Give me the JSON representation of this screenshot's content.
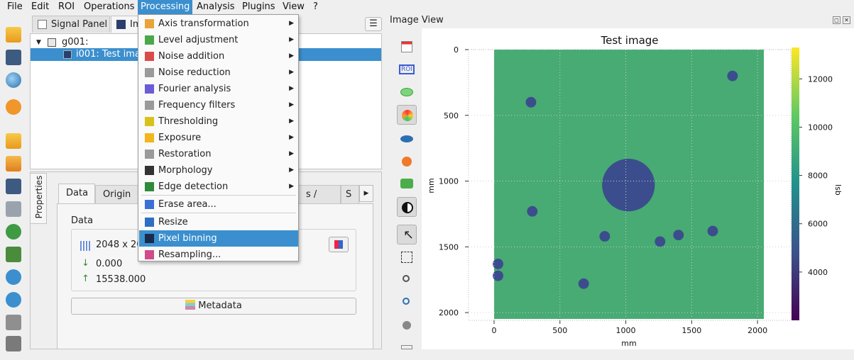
{
  "menubar": {
    "items": [
      "File",
      "Edit",
      "ROI",
      "Operations",
      "Processing",
      "Analysis",
      "Plugins",
      "View",
      "?"
    ],
    "active": "Processing"
  },
  "toolbar_icons": [
    "open-signal-icon",
    "save-icon",
    "search-icon",
    "settings-icon",
    "open-folder-icon",
    "upload-icon",
    "save-as-icon",
    "duplicate-icon",
    "refresh-icon",
    "import-icon",
    "move-up-icon",
    "move-down-icon",
    "copy-icon",
    "delete-icon"
  ],
  "panel_tabs": {
    "signal": "Signal Panel",
    "image": "Im"
  },
  "tree": {
    "group": "g001:",
    "item": "i001: Test imag"
  },
  "properties": {
    "side_label": "Properties",
    "tabs": [
      "Data",
      "Origin /",
      "s / Units",
      "S"
    ],
    "section_title": "Data",
    "size": "2048 x 20",
    "min": "0.000",
    "max": "15538.000",
    "metadata_label": "Metadata"
  },
  "processing_menu": [
    {
      "label": "Axis transformation",
      "icon": "axis-icon",
      "submenu": true
    },
    {
      "label": "Level adjustment",
      "icon": "level-icon",
      "submenu": true
    },
    {
      "label": "Noise addition",
      "icon": "noise-add-icon",
      "submenu": true
    },
    {
      "label": "Noise reduction",
      "icon": "noise-reduce-icon",
      "submenu": true
    },
    {
      "label": "Fourier analysis",
      "icon": "fourier-icon",
      "submenu": true
    },
    {
      "label": "Frequency filters",
      "icon": "filter-icon",
      "submenu": true
    },
    {
      "label": "Thresholding",
      "icon": "threshold-icon",
      "submenu": true
    },
    {
      "label": "Exposure",
      "icon": "exposure-icon",
      "submenu": true
    },
    {
      "label": "Restoration",
      "icon": "restoration-icon",
      "submenu": true
    },
    {
      "label": "Morphology",
      "icon": "morphology-icon",
      "submenu": true
    },
    {
      "label": "Edge detection",
      "icon": "edge-icon",
      "submenu": true
    },
    {
      "label": "Erase area...",
      "icon": "eraser-icon",
      "submenu": false
    },
    {
      "label": "Resize",
      "icon": "resize-icon",
      "submenu": false
    },
    {
      "label": "Pixel binning",
      "icon": "binning-icon",
      "submenu": false,
      "highlighted": true
    },
    {
      "label": "Resampling...",
      "icon": "resampling-icon",
      "submenu": false
    }
  ],
  "image_view": {
    "title": "Image View",
    "plot_title": "Test image",
    "xlabel": "mm",
    "ylabel": "mm",
    "colorbar_label": "lsb",
    "x_ticks": [
      "0",
      "500",
      "1000",
      "1500",
      "2000"
    ],
    "y_ticks": [
      "0",
      "500",
      "1000",
      "1500",
      "2000"
    ],
    "cbar_ticks": [
      "12000",
      "10000",
      "8000",
      "6000",
      "4000"
    ]
  },
  "chart_data": {
    "type": "heatmap",
    "title": "Test image",
    "xlabel": "mm",
    "ylabel": "mm",
    "colorbar_label": "lsb",
    "xlim": [
      0,
      2048
    ],
    "ylim": [
      2048,
      0
    ],
    "colorbar_range": [
      2000,
      13300
    ],
    "colormap": "viridis",
    "background_value": 7400,
    "spots": [
      {
        "x": 1810,
        "y": 200,
        "r": 40
      },
      {
        "x": 280,
        "y": 400,
        "r": 40
      },
      {
        "x": 1020,
        "y": 1030,
        "r": 200
      },
      {
        "x": 290,
        "y": 1230,
        "r": 40
      },
      {
        "x": 840,
        "y": 1420,
        "r": 40
      },
      {
        "x": 1260,
        "y": 1460,
        "r": 40
      },
      {
        "x": 1400,
        "y": 1410,
        "r": 40
      },
      {
        "x": 1660,
        "y": 1380,
        "r": 40
      },
      {
        "x": 30,
        "y": 1630,
        "r": 40
      },
      {
        "x": 30,
        "y": 1720,
        "r": 40
      },
      {
        "x": 680,
        "y": 1780,
        "r": 40
      }
    ]
  }
}
